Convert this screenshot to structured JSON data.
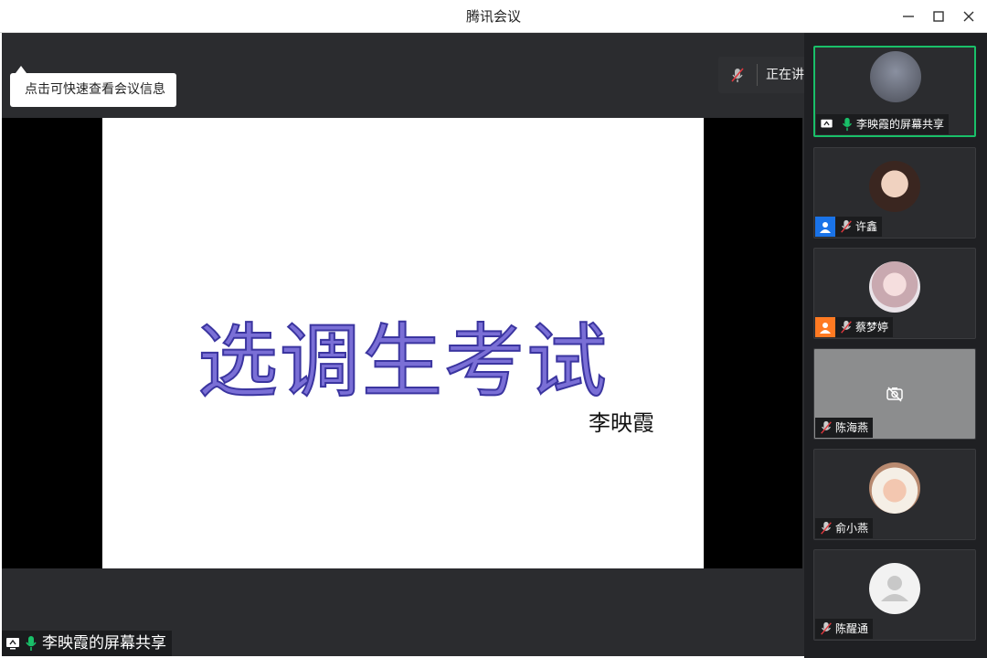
{
  "window": {
    "title": "腾讯会议"
  },
  "tip": {
    "text": "点击可快速查看会议信息"
  },
  "speaking": {
    "text": "正在讲话: 李映霞;"
  },
  "slide": {
    "title": "选调生考试",
    "author": "李映霞"
  },
  "main_label": {
    "text": "李映霞的屏幕共享"
  },
  "participants": [
    {
      "name": "李映霞的屏幕共享",
      "mic": "on",
      "role": "share",
      "active": true
    },
    {
      "name": "许鑫",
      "mic": "muted",
      "role": "host"
    },
    {
      "name": "蔡梦婷",
      "mic": "muted",
      "role": "cohost"
    },
    {
      "name": "陈海燕",
      "mic": "muted",
      "role": "none",
      "camera": "off"
    },
    {
      "name": "俞小燕",
      "mic": "muted",
      "role": "none"
    },
    {
      "name": "陈醒通",
      "mic": "muted",
      "role": "none"
    }
  ],
  "colors": {
    "active_border": "#19c069",
    "mic_on": "#19c069",
    "host": "#1a73e8",
    "cohost": "#ff7a22",
    "slide_text": "#7a6fd6"
  },
  "icons": [
    "minimize-icon",
    "maximize-icon",
    "close-icon",
    "mic-muted-icon",
    "mic-on-icon",
    "screen-share-icon",
    "user-icon",
    "camera-off-icon"
  ]
}
